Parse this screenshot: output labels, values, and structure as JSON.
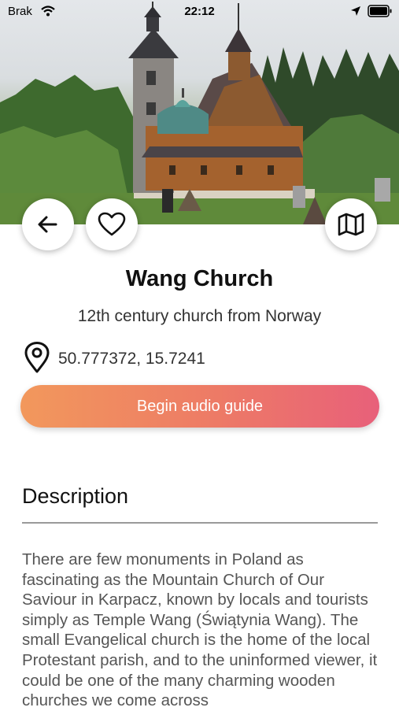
{
  "status_bar": {
    "carrier": "Brak",
    "time": "22:12"
  },
  "place": {
    "name": "Wang Church",
    "subtitle": "12th century church from Norway",
    "coordinates": "50.777372, 15.7241"
  },
  "actions": {
    "audio_guide_label": "Begin audio guide"
  },
  "description": {
    "heading": "Description",
    "text": "There are few monuments in Poland as fascinating as the Mountain Church of Our Saviour in Karpacz, known by locals and tourists simply as Temple Wang (Świątynia Wang). The small Evangelical church is the home of the local Protestant parish, and to the uninformed viewer, it could be one of the many charming wooden churches we come across"
  },
  "icons": {
    "back": "arrow-left-icon",
    "favorite": "heart-outline-icon",
    "map": "map-icon",
    "location": "location-pin-icon",
    "wifi": "wifi-icon",
    "location_services": "location-arrow-icon",
    "battery": "battery-icon"
  },
  "colors": {
    "accent_start": "#f2985c",
    "accent_end": "#e8607a"
  }
}
